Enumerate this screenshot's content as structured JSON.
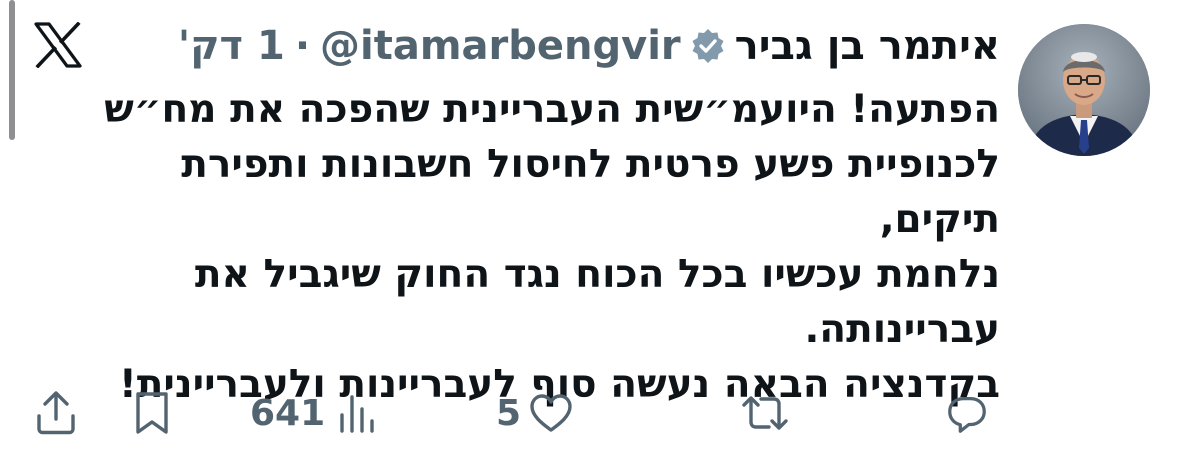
{
  "post": {
    "display_name": "איתמר בן גביר",
    "handle": "@itamarbengvir",
    "separator": "·",
    "time": "1 דק'",
    "body": "הפתעה! היועמ״שית העבריינית שהפכה את מח״ש\nלכנופיית פשע פרטית לחיסול חשבונות ותפירת תיקים,\nנלחמת עכשיו בכל הכוח נגד החוק שיגביל את\nעבריינותה.\nבקדנציה הבאה נעשה סוף לעבריינות ולעבריינית!"
  },
  "icons": {
    "brand": "x-logo-icon",
    "verified": "verified-badge-icon",
    "share": "share-icon",
    "bookmark": "bookmark-icon",
    "views": "views-chart-icon",
    "like": "heart-icon",
    "repost": "repost-icon",
    "reply": "reply-icon"
  },
  "actions": {
    "views_count": "641",
    "likes_count": "5"
  },
  "colors": {
    "text_primary": "#0f1419",
    "text_secondary": "#536471",
    "verified_badge": "#829aab",
    "background": "#ffffff"
  }
}
